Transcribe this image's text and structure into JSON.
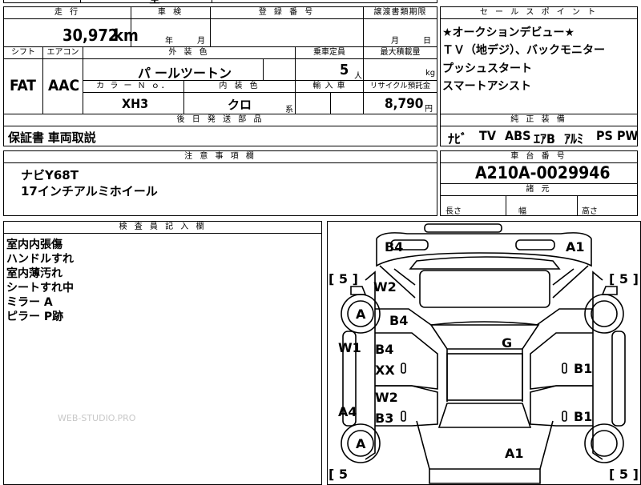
{
  "top_fragment": "全",
  "mileage": {
    "header": "走 行",
    "value": "30,972",
    "unit": "km"
  },
  "shaken": {
    "header": "車 検",
    "year_label": "年",
    "month_label": "月"
  },
  "registration": {
    "header": "登 録 番 号",
    "value": ""
  },
  "transfer_deadline": {
    "header": "譲渡書類期限",
    "month_label": "月",
    "day_label": "日"
  },
  "selling_points": {
    "header": "セ ー ル ス ポ イ ン ト",
    "lines": [
      "★オークションデビュー★",
      "ＴＶ（地デジ）、バックモニター",
      "プッシュスタート",
      "スマートアシスト"
    ]
  },
  "shift": {
    "header": "シフト",
    "value": "FAT"
  },
  "aircon": {
    "header": "エアコン",
    "value": "AAC"
  },
  "exterior_color": {
    "header": "外 装 色",
    "value": "パ ールツートン"
  },
  "capacity": {
    "header": "乗車定員",
    "value": "5",
    "unit": "人"
  },
  "max_load": {
    "header": "最大積載量",
    "value": "",
    "unit": "kg"
  },
  "color_no": {
    "header": "カ ラ ー Ｎ ｏ．",
    "value": "XH3"
  },
  "interior_color": {
    "header": "内 装 色",
    "value": "クロ",
    "suffix": "系"
  },
  "import": {
    "header": "輸 入 車",
    "value": ""
  },
  "recycle": {
    "header": "リサイクル預託金",
    "value": "8,790",
    "unit": "円"
  },
  "equipment": {
    "header": "純 正 装 備",
    "items": [
      "ﾅﾋﾞ",
      "TV",
      "ABS",
      "ｴｱB",
      "ｱﾙﾐ",
      "PS",
      "PW"
    ]
  },
  "shipping_parts": {
    "header": "後 日 発 送 部 品",
    "value": "保証書 車両取説"
  },
  "notes": {
    "header": "注 意 事 項 欄",
    "lines": [
      "ナビY68T",
      "17インチアルミホイール"
    ]
  },
  "chassis": {
    "header": "車 台 番 号",
    "value": "A210A-0029946"
  },
  "dimensions": {
    "header": "諸 元",
    "length": "長さ",
    "width": "幅",
    "height": "高さ"
  },
  "inspector": {
    "header": "検 査 員 記 入 欄",
    "lines": [
      "室内内張傷",
      "ハンドルすれ",
      "室内薄汚れ",
      "シートすれ中",
      "ミラー A",
      "ピラー P跡"
    ]
  },
  "watermark": "WEB-STUDIO.PRO",
  "diagram": {
    "labels": {
      "front_left": "B4",
      "front_right": "A1",
      "tire_fl": "[ 5 ]",
      "tire_fr": "[ 5 ]",
      "tire_rl": "[ 5",
      "tire_rr": "[ 5 ]",
      "fender_l": "W2",
      "wheel_fl": "A",
      "wheel_rl": "A",
      "hood": "B4",
      "roof": "G",
      "door_fl_1": "B4",
      "door_fl_2": "XX",
      "door_rl_1": "W2",
      "door_rl_2": "B3",
      "door_fr": "B1",
      "door_rr": "B1",
      "sill_l_1": "W1",
      "sill_l_2": "A4",
      "trunk": "A1"
    }
  }
}
